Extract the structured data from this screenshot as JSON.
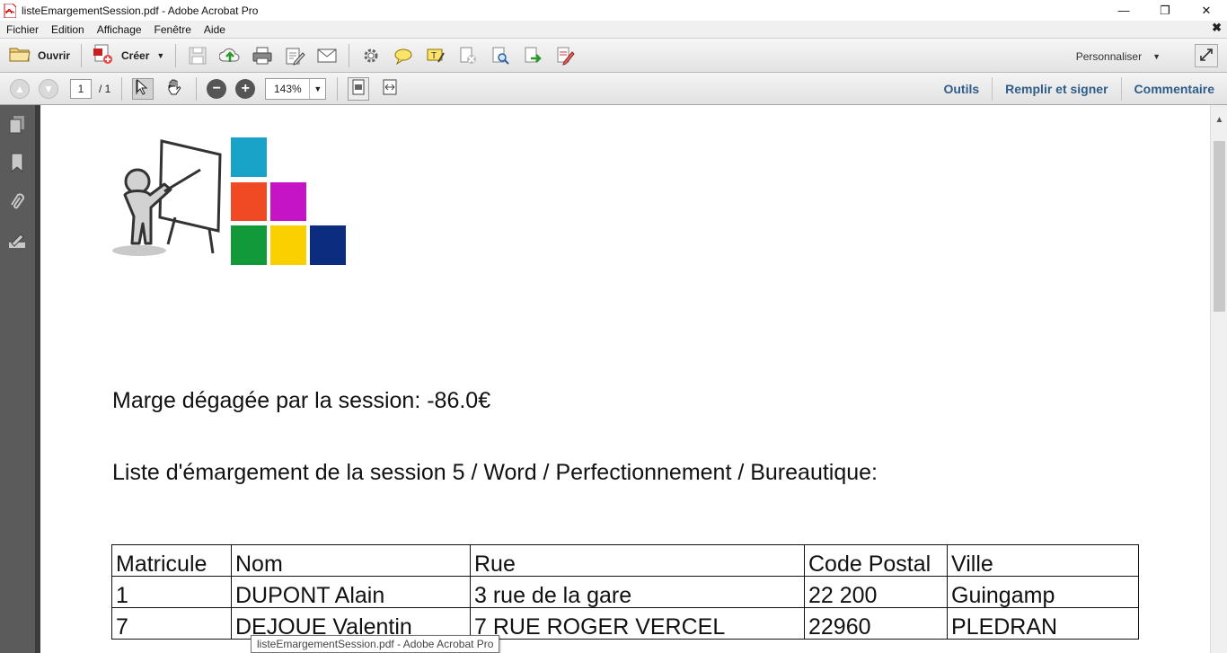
{
  "window": {
    "title": "listeEmargementSession.pdf - Adobe Acrobat Pro",
    "minimize": "—",
    "restore": "❐",
    "close": "✕"
  },
  "menu": {
    "items": [
      "Fichier",
      "Edition",
      "Affichage",
      "Fenêtre",
      "Aide"
    ],
    "close": "✖"
  },
  "toolbar": {
    "open_label": "Ouvrir",
    "create_label": "Créer",
    "customize_label": "Personnaliser",
    "icons": [
      "save-icon",
      "upload-cloud-icon",
      "print-icon",
      "edit-document-icon",
      "email-icon",
      "settings-icon",
      "comment-icon",
      "highlight-icon",
      "remove-icon",
      "search-document-icon",
      "export-icon",
      "sign-icon"
    ]
  },
  "navbar": {
    "page_current": "1",
    "page_total": "/ 1",
    "zoom": "143%",
    "tools_label": "Outils",
    "fill_sign_label": "Remplir et signer",
    "comment_label": "Commentaire"
  },
  "document": {
    "marge_text": "Marge dégagée par la session: -86.0€",
    "liste_text": "Liste d'émargement de la session 5 / Word / Perfectionnement / Bureautique:",
    "table": {
      "headers": [
        "Matricule",
        "Nom",
        "Rue",
        "Code Postal",
        "Ville"
      ],
      "rows": [
        [
          "1",
          "DUPONT Alain",
          "3 rue de la gare",
          "22 200",
          "Guingamp"
        ],
        [
          "7",
          "DEJOUE Valentin",
          "7 RUE ROGER VERCEL",
          "22960",
          "PLEDRAN"
        ]
      ]
    },
    "logo_colors": [
      "#1aa3c9",
      "#f04a24",
      "#c514c5",
      "#129a3a",
      "#fbd000",
      "#0c2c80"
    ]
  },
  "tooltip": "listeEmargementSession.pdf - Adobe Acrobat Pro",
  "colors": {
    "panel_link": "#2e5d8a",
    "left_pane": "#5b5b5b"
  }
}
